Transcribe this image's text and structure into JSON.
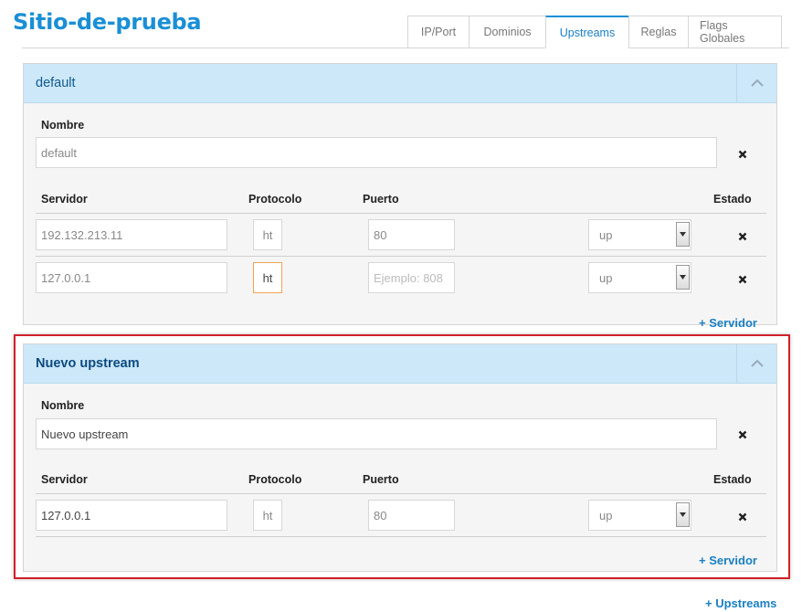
{
  "site": {
    "title": "Sitio-de-prueba"
  },
  "tabs": [
    {
      "label": "IP/Port"
    },
    {
      "label": "Dominios"
    },
    {
      "label": "Upstreams",
      "active": true
    },
    {
      "label": "Reglas"
    },
    {
      "label": "Flags Globales"
    }
  ],
  "upstreams": [
    {
      "title": "default",
      "name_label": "Nombre",
      "name_value": "default",
      "columns": {
        "servidor": "Servidor",
        "protocolo": "Protocolo",
        "puerto": "Puerto",
        "estado": "Estado"
      },
      "rows": [
        {
          "servidor": "192.132.213.11",
          "protocolo": "ht",
          "puerto": "80",
          "puerto_placeholder": "",
          "estado": "up"
        },
        {
          "servidor": "127.0.0.1",
          "protocolo": "ht",
          "puerto": "",
          "puerto_placeholder": "Ejemplo: 808",
          "estado": "up"
        }
      ],
      "add_server": "+ Servidor"
    },
    {
      "title": "Nuevo upstream",
      "name_label": "Nombre",
      "name_value": "Nuevo upstream",
      "columns": {
        "servidor": "Servidor",
        "protocolo": "Protocolo",
        "puerto": "Puerto",
        "estado": "Estado"
      },
      "rows": [
        {
          "servidor": "127.0.0.1",
          "protocolo": "ht",
          "puerto": "80",
          "estado": "up"
        }
      ],
      "add_server": "+ Servidor"
    }
  ],
  "add_upstream": "+ Upstreams",
  "colors": {
    "accent": "#1a8fd6",
    "panel_header": "#cce8f9",
    "highlight": "#d0202a",
    "focus": "#f0a457"
  }
}
